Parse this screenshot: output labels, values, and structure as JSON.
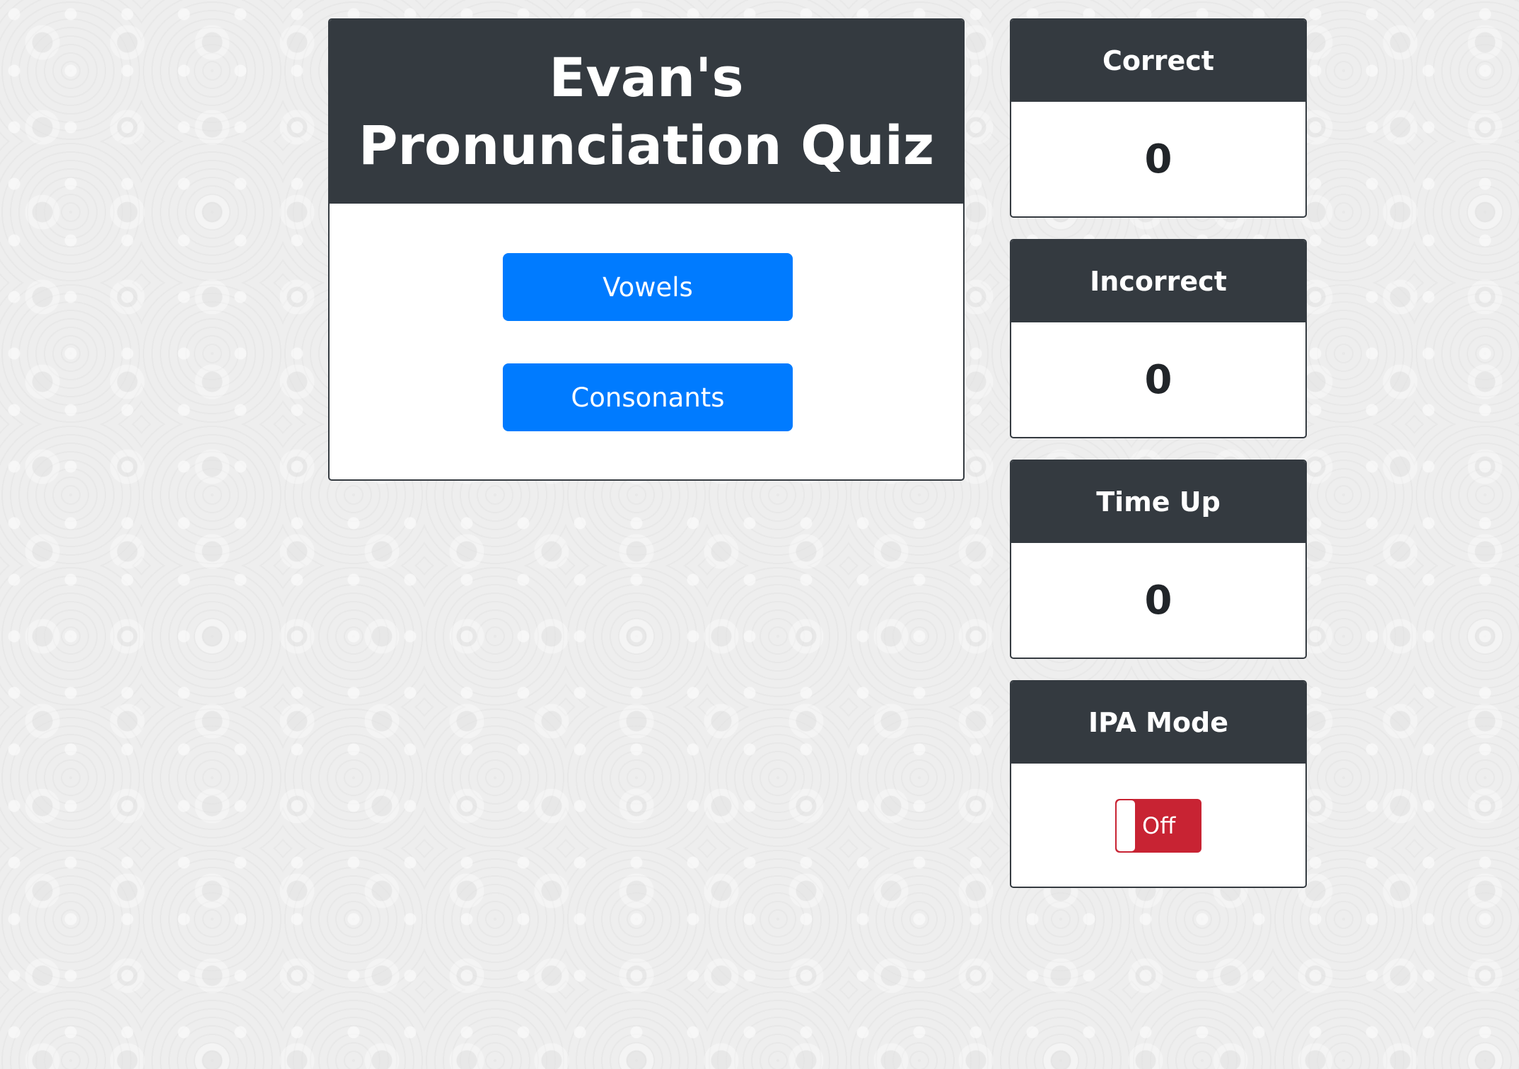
{
  "main": {
    "title": "Evan's Pronunciation Quiz",
    "buttons": {
      "vowels": "Vowels",
      "consonants": "Consonants"
    }
  },
  "stats": {
    "correct": {
      "label": "Correct",
      "value": "0"
    },
    "incorrect": {
      "label": "Incorrect",
      "value": "0"
    },
    "time_up": {
      "label": "Time Up",
      "value": "0"
    }
  },
  "ipa_mode": {
    "label": "IPA Mode",
    "toggle_state": "Off"
  },
  "colors": {
    "header_bg": "#343a40",
    "primary": "#007bff",
    "toggle_off": "#c82333"
  }
}
